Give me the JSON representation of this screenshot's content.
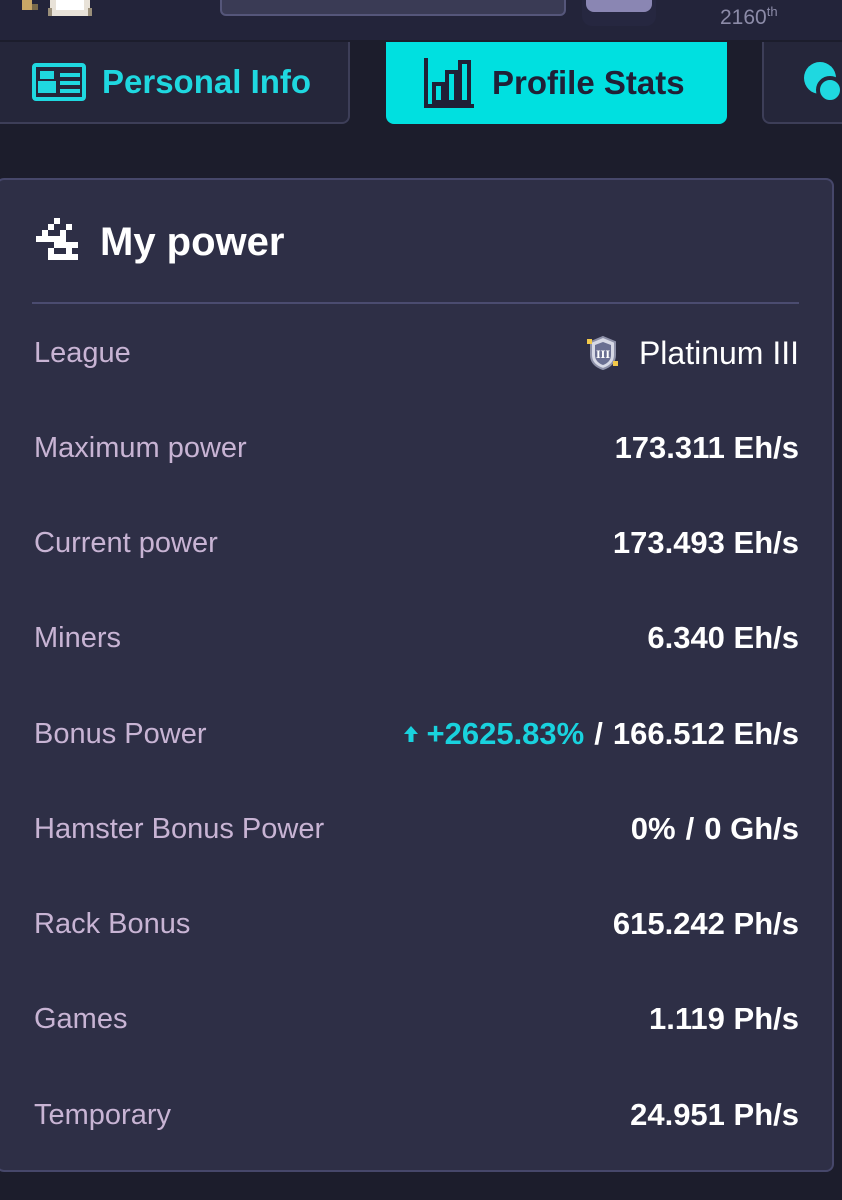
{
  "header": {
    "rank_number": "2160",
    "rank_suffix": "th"
  },
  "tabs": [
    {
      "label": "Personal Info",
      "icon": "id-card-icon",
      "active": false
    },
    {
      "label": "Profile Stats",
      "icon": "bar-chart-icon",
      "active": true
    },
    {
      "label": "",
      "icon": "chat-icon",
      "active": false
    }
  ],
  "colors": {
    "accent": "#00e0e0",
    "card_bg": "#2e2f46",
    "label": "#c8b4d4",
    "bonus": "#19d2de"
  },
  "power": {
    "title": "My power",
    "title_icon": "lightning-icon",
    "rows": [
      {
        "label": "League",
        "value": "Platinum III",
        "icon": "platinum-league-badge-icon"
      },
      {
        "label": "Maximum power",
        "value": "173.311 Eh/s"
      },
      {
        "label": "Current power",
        "value": "173.493 Eh/s"
      },
      {
        "label": "Miners",
        "value": "6.340 Eh/s"
      },
      {
        "label": "Bonus Power",
        "percent": "+2625.83%",
        "separator": "/",
        "value": "166.512 Eh/s"
      },
      {
        "label": "Hamster Bonus Power",
        "percent": "0%",
        "separator": "/",
        "value": "0 Gh/s"
      },
      {
        "label": "Rack Bonus",
        "value": "615.242 Ph/s"
      },
      {
        "label": "Games",
        "value": "1.119 Ph/s"
      },
      {
        "label": "Temporary",
        "value": "24.951 Ph/s"
      }
    ]
  }
}
